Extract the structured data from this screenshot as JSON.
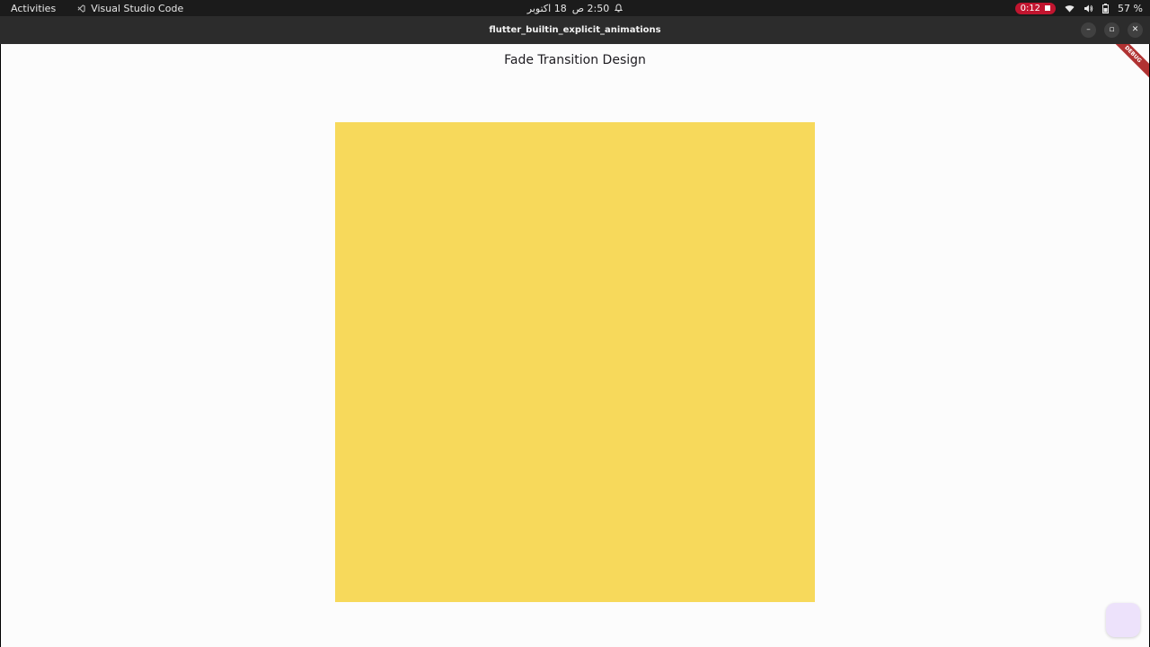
{
  "system_bar": {
    "activities": "Activities",
    "focused_app": "Visual Studio Code",
    "date": "18 اكتوبر",
    "time": "2:50 ص",
    "recording_time": "0:12",
    "battery": "57 %"
  },
  "window": {
    "title": "flutter_builtin_explicit_animations",
    "buttons": {
      "minimize": "–",
      "maximize": "▫",
      "close": "✕"
    }
  },
  "app": {
    "title": "Fade Transition Design",
    "debug_banner": "DEBUG"
  },
  "colors": {
    "box": "#f7d95b",
    "fab": "#ede2fb",
    "record": "#c1152f",
    "debug_banner": "#b03232"
  }
}
